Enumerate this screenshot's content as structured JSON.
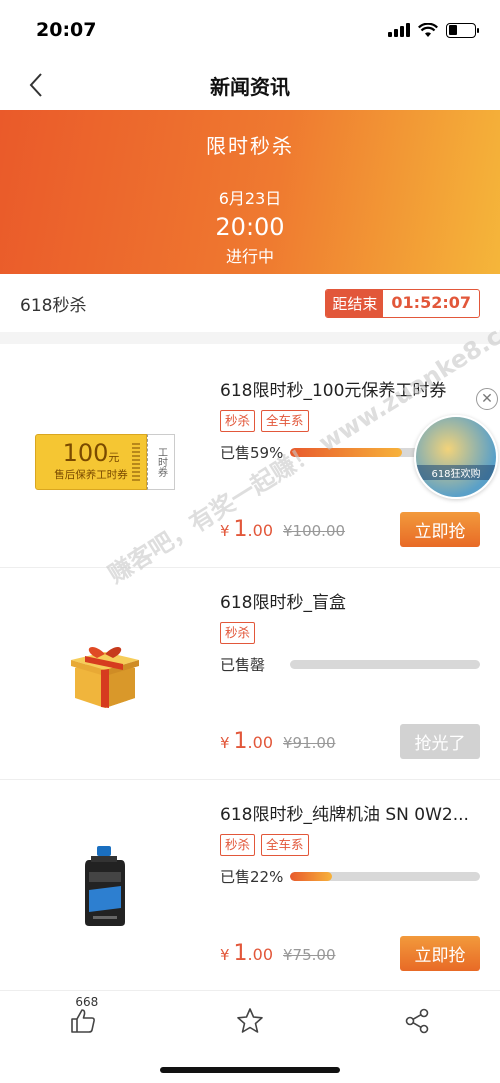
{
  "status_bar": {
    "time": "20:07",
    "battery_level": 0.35
  },
  "nav": {
    "title": "新闻资讯"
  },
  "banner": {
    "title": "限时秒杀",
    "date": "6月23日",
    "time": "20:00",
    "status": "进行中"
  },
  "countdown": {
    "label": "618秒杀",
    "tag": "距结束",
    "time": "01:52:07"
  },
  "products": [
    {
      "name": "618限时秒_100元保养工时券",
      "tags": [
        "秒杀",
        "全车系"
      ],
      "sold_label": "已售59%",
      "sold_fraction": 0.59,
      "price_currency": "¥",
      "price_int": "1",
      "price_dec": ".00",
      "price_old": "¥100.00",
      "button": "立即抢",
      "coupon": {
        "amount": "100",
        "unit": "元",
        "desc": "售后保养工时券",
        "side": "工时券"
      }
    },
    {
      "name": "618限时秒_盲盒",
      "tags": [
        "秒杀"
      ],
      "sold_label": "已售罄",
      "sold_fraction": 0,
      "price_currency": "¥",
      "price_int": "1",
      "price_dec": ".00",
      "price_old": "¥91.00",
      "button": "抢光了"
    },
    {
      "name": "618限时秒_纯牌机油 SN 0W2...",
      "tags": [
        "秒杀",
        "全车系"
      ],
      "sold_label": "已售22%",
      "sold_fraction": 0.22,
      "price_currency": "¥",
      "price_int": "1",
      "price_dec": ".00",
      "price_old": "¥75.00",
      "button": "立即抢"
    }
  ],
  "float_ad": {
    "text": "618狂欢购"
  },
  "watermark": {
    "line": "赚客吧，有奖一起赚！ www.zuanke8.com"
  },
  "bottom": {
    "like_count": "668"
  },
  "colors": {
    "accent": "#e2573a",
    "banner_start": "#ea5a2a",
    "banner_end": "#f5b63a"
  }
}
